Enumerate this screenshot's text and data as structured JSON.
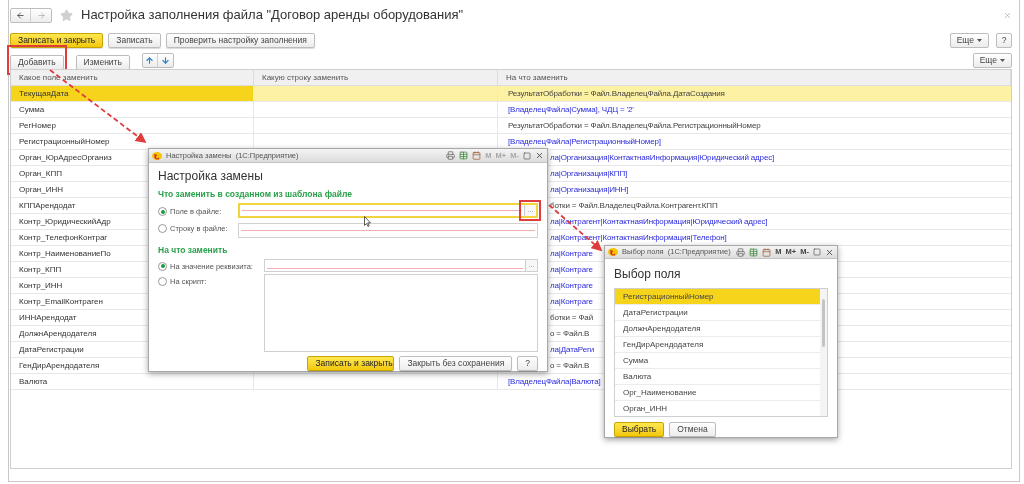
{
  "window": {
    "title": "Настройка заполнения файла \"Договор аренды оборудования\""
  },
  "toolbar": {
    "buttons": [
      {
        "label": "Записать и закрыть",
        "kind": "primary"
      },
      {
        "label": "Записать",
        "kind": "default"
      },
      {
        "label": "Проверить настройку заполнения",
        "kind": "default"
      }
    ],
    "more": "Еще",
    "help": "?"
  },
  "table_toolbar": {
    "buttons": [
      {
        "label": "Добавить",
        "kind": "default",
        "highlighted": true
      },
      {
        "label": "Изменить",
        "kind": "default",
        "highlighted": false
      }
    ],
    "more": "Еще"
  },
  "table": {
    "columns": [
      "Какое поле заменить",
      "Какую строку заменить",
      "На что заменить"
    ],
    "rows": [
      {
        "field": "ТекущаяДата",
        "replacement": "РезультатОбработки = Файл.ВладелецФайла.ДатаСоздания",
        "kind": "script",
        "selected": true
      },
      {
        "field": "Сумма",
        "replacement": "[ВладелецФайла|Сумма], ЧДЦ = '2'",
        "kind": "attribute",
        "selected": false
      },
      {
        "field": "РегНомер",
        "replacement": "РезультатОбработки = Файл.ВладелецФайла.РегистрационныйНомер",
        "kind": "script",
        "selected": false
      },
      {
        "field": "РегистрационныйНомер",
        "replacement": "[ВладелецФайла|РегистрационныйНомер]",
        "kind": "attribute",
        "selected": false
      },
      {
        "field": "Орган_ЮрАдресОрганиз",
        "replacement": "ла|Организация|КонтактнаяИнформация|Юридический адрес]",
        "kind": "attribute",
        "selected": false
      },
      {
        "field": "Орган_КПП",
        "replacement": "ла|Организация|КПП]",
        "kind": "attribute",
        "selected": false
      },
      {
        "field": "Орган_ИНН",
        "replacement": "ла|Организация|ИНН]",
        "kind": "attribute",
        "selected": false
      },
      {
        "field": "КППАрендодат",
        "replacement": "ботки = Файл.ВладелецФайла.Контрагент.КПП",
        "kind": "script",
        "selected": false
      },
      {
        "field": "Контр_ЮридическийАдр",
        "replacement": "ла|Контрагент|КонтактнаяИнформация|Юридический адрес]",
        "kind": "attribute",
        "selected": false
      },
      {
        "field": "Контр_ТелефонКонтраг",
        "replacement": "ла|Контрагент|КонтактнаяИнформация|Телефон]",
        "kind": "attribute",
        "selected": false
      },
      {
        "field": "Контр_НаименованиеПо",
        "replacement": "ла|Контраге",
        "kind": "attribute",
        "selected": false
      },
      {
        "field": "Контр_КПП",
        "replacement": "ла|Контраге",
        "kind": "attribute",
        "selected": false
      },
      {
        "field": "Контр_ИНН",
        "replacement": "ла|Контраге",
        "kind": "attribute",
        "selected": false
      },
      {
        "field": "Контр_EmailКонтраген",
        "replacement": "ла|Контраге",
        "kind": "attribute",
        "selected": false
      },
      {
        "field": "ИННАрендодат",
        "replacement": "ботки = Фай",
        "kind": "script",
        "selected": false
      },
      {
        "field": "ДолжнАрендодателя",
        "replacement": "о = Файл.В",
        "kind": "script",
        "selected": false
      },
      {
        "field": "ДатаРегистрации",
        "replacement": "ла|ДатаРеги",
        "kind": "attribute",
        "selected": false
      },
      {
        "field": "ГенДирАрендодателя",
        "replacement": "о = Файл.В",
        "kind": "script",
        "selected": false
      },
      {
        "field": "Валюта",
        "replacement": "[ВладелецФайла|Валюта]",
        "kind": "attribute",
        "selected": false
      }
    ]
  },
  "replace_dialog": {
    "title": "Настройка замены  (1С:Предприятие)",
    "memory_buttons": [
      {
        "label": "M",
        "disabled": true
      },
      {
        "label": "M+",
        "disabled": true
      },
      {
        "label": "M-",
        "disabled": true
      }
    ],
    "heading": "Настройка замены",
    "what_section": "Что заменить в созданном из шаблона файле",
    "what_options": [
      {
        "label": "Поле в файле:",
        "selected": true,
        "focused": true,
        "choose": "...",
        "highlighted": true
      },
      {
        "label": "Строку в файле:",
        "selected": false,
        "focused": false
      }
    ],
    "with_section": "На что заменить",
    "with_options": [
      {
        "label": "На значение реквизита:",
        "selected": true,
        "kind": "field",
        "choose": "..."
      },
      {
        "label": "На скрипт:",
        "selected": false,
        "kind": "textarea"
      }
    ],
    "buttons": [
      {
        "label": "Записать и закрыть",
        "kind": "primary"
      },
      {
        "label": "Закрыть без сохранения",
        "kind": "default"
      },
      {
        "label": "?",
        "kind": "default"
      }
    ]
  },
  "field_picker": {
    "title": "Выбор поля  (1С:Предприятие)",
    "memory_buttons": [
      {
        "label": "M",
        "disabled": false
      },
      {
        "label": "M+",
        "disabled": false
      },
      {
        "label": "M-",
        "disabled": false
      }
    ],
    "heading": "Выбор поля",
    "items": [
      {
        "label": "РегистрационныйНомер",
        "selected": true
      },
      {
        "label": "ДатаРегистрации",
        "selected": false
      },
      {
        "label": "ДолжнАрендодателя",
        "selected": false
      },
      {
        "label": "ГенДирАрендодателя",
        "selected": false
      },
      {
        "label": "Сумма",
        "selected": false
      },
      {
        "label": "Валюта",
        "selected": false
      },
      {
        "label": "Орг_Наименование",
        "selected": false
      },
      {
        "label": "Орган_ИНН",
        "selected": false
      }
    ],
    "buttons": [
      {
        "label": "Выбрать",
        "kind": "primary"
      },
      {
        "label": "Отмена",
        "kind": "default"
      }
    ]
  }
}
